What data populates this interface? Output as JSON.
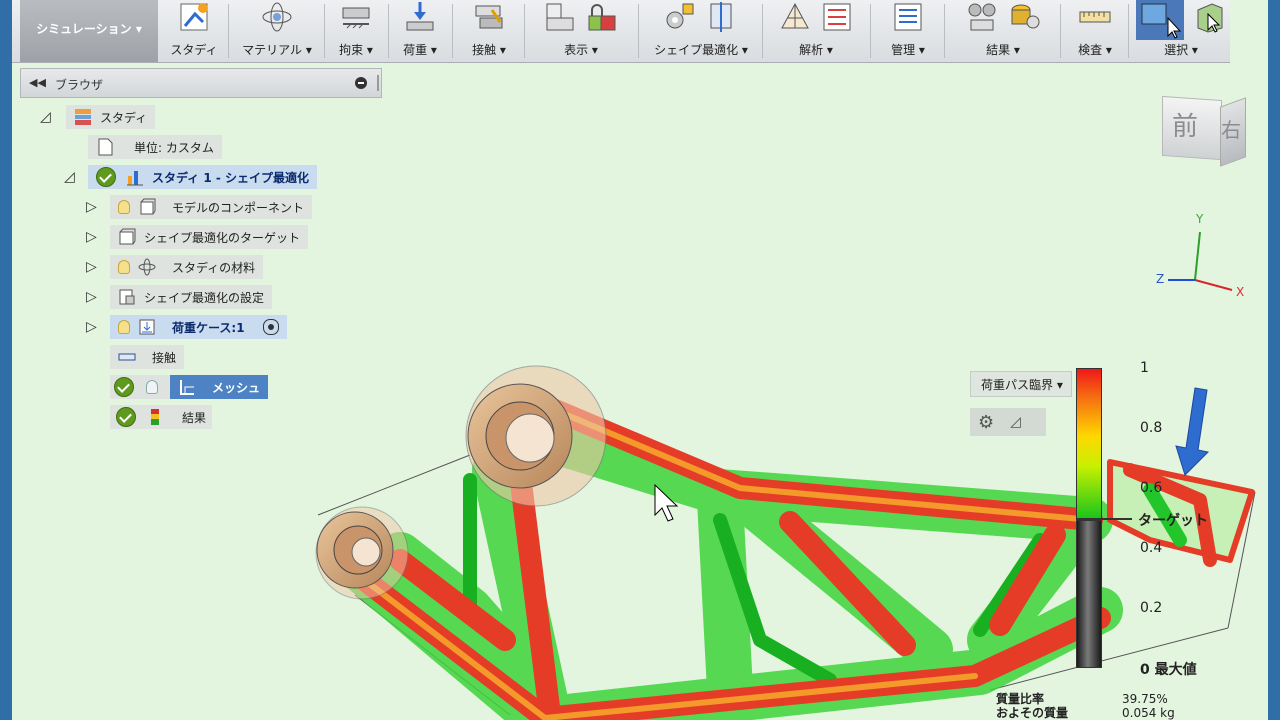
{
  "toolbar": {
    "mode": "シミュレーション ▾",
    "groups": [
      {
        "label": "スタディ"
      },
      {
        "label": "マテリアル ▾"
      },
      {
        "label": "拘束 ▾"
      },
      {
        "label": "荷重 ▾"
      },
      {
        "label": "接触 ▾"
      },
      {
        "label": "表示 ▾"
      },
      {
        "label": "シェイプ最適化 ▾"
      },
      {
        "label": "解析 ▾"
      },
      {
        "label": "管理 ▾"
      },
      {
        "label": "結果 ▾"
      },
      {
        "label": "検査 ▾"
      },
      {
        "label": "選択 ▾"
      }
    ]
  },
  "browser": {
    "title": "ブラウザ",
    "nodes": {
      "study_root": "スタディ",
      "units": "単位: カスタム",
      "study1": "スタディ 1 - シェイプ最適化",
      "components": "モデルのコンポーネント",
      "target": "シェイプ最適化のターゲット",
      "material": "スタディの材料",
      "settings": "シェイプ最適化の設定",
      "load_case": "荷重ケース:1",
      "contact": "接触",
      "mesh": "メッシュ",
      "results": "結果"
    }
  },
  "viewcube": {
    "front": "前",
    "right": "右"
  },
  "axes": {
    "x": "X",
    "y": "Y",
    "z": "Z"
  },
  "legend": {
    "dropdown": "荷重パス臨界 ▾",
    "ticks": [
      "1",
      "0.8",
      "0.6",
      "0.4",
      "0.2",
      "0 最大値"
    ],
    "target_label": "ターゲット"
  },
  "stats": {
    "mass_ratio_label": "質量比率",
    "mass_ratio_value": "39.75%",
    "mass_label": "およその質量",
    "mass_value": "0.054 kg"
  },
  "colors": {
    "critical": "#e8402a",
    "mid": "#f4e400",
    "low": "#22c52a",
    "background": "#e3f4df"
  }
}
